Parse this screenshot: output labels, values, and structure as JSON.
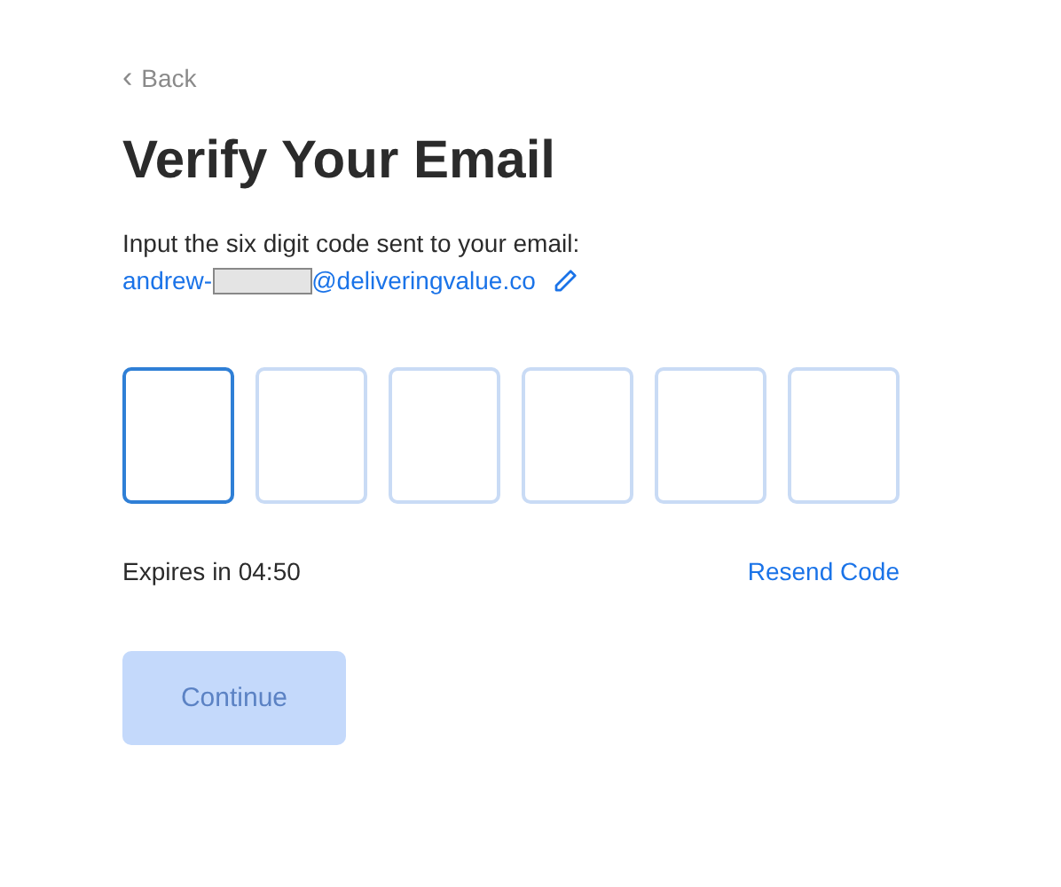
{
  "back": {
    "icon": "‹",
    "label": "Back"
  },
  "title": "Verify Your Email",
  "instruction": "Input the six digit code sent to your email:",
  "email": {
    "before": "andrew-",
    "redacted": true,
    "after": "@deliveringvalue.co"
  },
  "code_boxes": [
    {
      "focused": true
    },
    {
      "focused": false
    },
    {
      "focused": false
    },
    {
      "focused": false
    },
    {
      "focused": false
    },
    {
      "focused": false
    }
  ],
  "expires": "Expires in 04:50",
  "resend": "Resend Code",
  "continue": {
    "label": "Continue",
    "disabled": true
  }
}
